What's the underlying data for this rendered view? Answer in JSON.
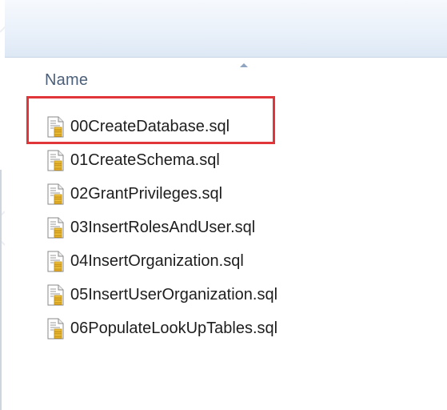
{
  "columns": {
    "name_label": "Name",
    "sort_direction": "ascending"
  },
  "files": [
    {
      "name": "00CreateDatabase.sql",
      "icon": "sql-file-icon",
      "highlighted": true
    },
    {
      "name": "01CreateSchema.sql",
      "icon": "sql-file-icon",
      "highlighted": false
    },
    {
      "name": "02GrantPrivileges.sql",
      "icon": "sql-file-icon",
      "highlighted": false
    },
    {
      "name": "03InsertRolesAndUser.sql",
      "icon": "sql-file-icon",
      "highlighted": false
    },
    {
      "name": "04InsertOrganization.sql",
      "icon": "sql-file-icon",
      "highlighted": false
    },
    {
      "name": "05InsertUserOrganization.sql",
      "icon": "sql-file-icon",
      "highlighted": false
    },
    {
      "name": "06PopulateLookUpTables.sql",
      "icon": "sql-file-icon",
      "highlighted": false
    }
  ],
  "colors": {
    "highlight": "#e0363a",
    "header_text": "#4c607a",
    "file_text": "#1e1e1e"
  }
}
